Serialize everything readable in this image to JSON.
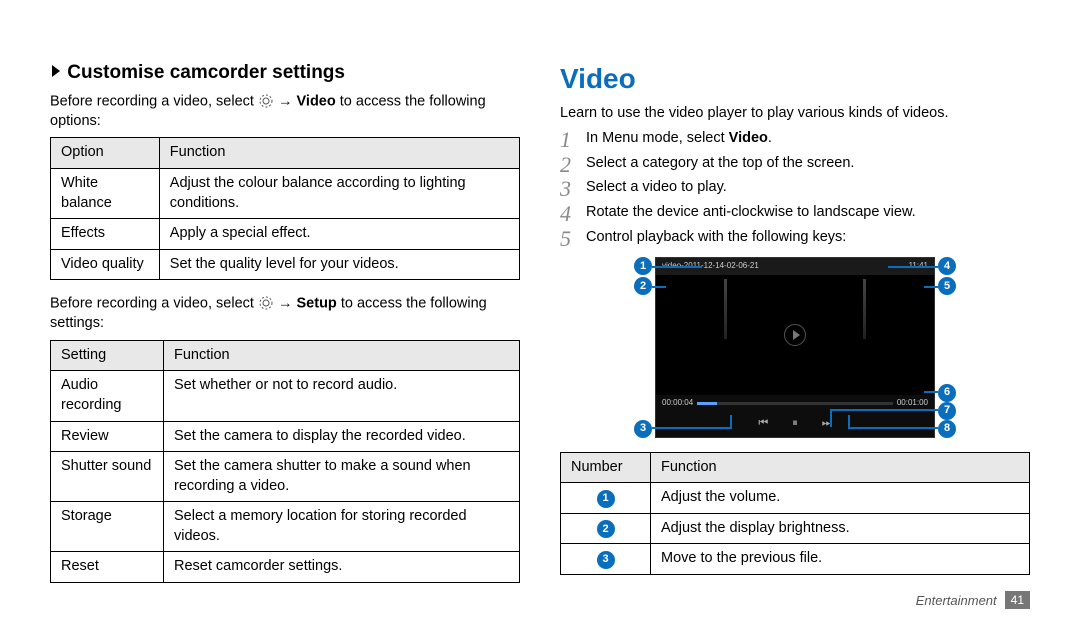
{
  "left": {
    "heading": "Customise camcorder settings",
    "intro_pre": "Before recording a video, select ",
    "intro_arrow": " → ",
    "intro_bold": "Video",
    "intro_post": " to access the following options:",
    "optionsTable": {
      "headers": [
        "Option",
        "Function"
      ],
      "rows": [
        [
          "White balance",
          "Adjust the colour balance according to lighting conditions."
        ],
        [
          "Effects",
          "Apply a special effect."
        ],
        [
          "Video quality",
          "Set the quality level for your videos."
        ]
      ]
    },
    "intro2_pre": "Before recording a video, select ",
    "intro2_arrow": " → ",
    "intro2_bold": "Setup",
    "intro2_post": " to access the following settings:",
    "settingsTable": {
      "headers": [
        "Setting",
        "Function"
      ],
      "rows": [
        [
          "Audio recording",
          "Set whether or not to record audio."
        ],
        [
          "Review",
          "Set the camera to display the recorded video."
        ],
        [
          "Shutter sound",
          "Set the camera shutter to make a sound when recording a video."
        ],
        [
          "Storage",
          "Select a memory location for storing recorded videos."
        ],
        [
          "Reset",
          "Reset camcorder settings."
        ]
      ]
    }
  },
  "right": {
    "sectionTitle": "Video",
    "lead": "Learn to use the video player to play various kinds of videos.",
    "steps": [
      {
        "pre": "In Menu mode, select ",
        "bold": "Video",
        "post": "."
      },
      {
        "pre": "Select a category at the top of the screen.",
        "bold": "",
        "post": ""
      },
      {
        "pre": "Select a video to play.",
        "bold": "",
        "post": ""
      },
      {
        "pre": "Rotate the device anti-clockwise to landscape view.",
        "bold": "",
        "post": ""
      },
      {
        "pre": "Control playback with the following keys:",
        "bold": "",
        "post": ""
      }
    ],
    "player": {
      "title": "video-2011-12-14-02-06-21",
      "clock": "11:41",
      "elapsed": "00:00:04",
      "total": "00:01:00",
      "callouts": [
        "1",
        "2",
        "3",
        "4",
        "5",
        "6",
        "7",
        "8"
      ]
    },
    "numberTable": {
      "headers": [
        "Number",
        "Function"
      ],
      "rows": [
        [
          "1",
          "Adjust the volume."
        ],
        [
          "2",
          "Adjust the display brightness."
        ],
        [
          "3",
          "Move to the previous file."
        ]
      ]
    }
  },
  "footer": {
    "chapter": "Entertainment",
    "page": "41"
  }
}
